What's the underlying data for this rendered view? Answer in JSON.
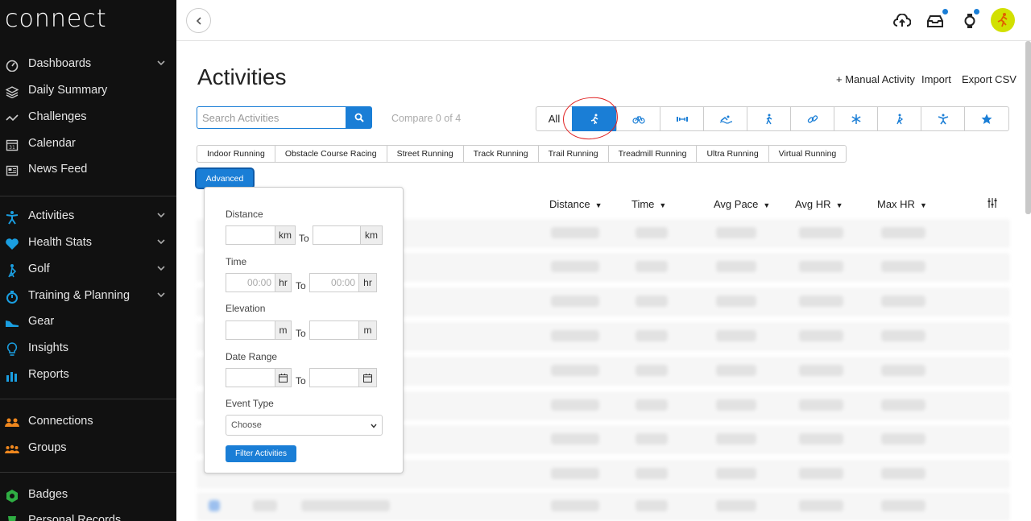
{
  "sidebar": {
    "logo": "connect",
    "items": [
      {
        "label": "Dashboards",
        "icon": "dashboard-icon",
        "chevron": true
      },
      {
        "label": "Daily Summary",
        "icon": "layers-icon",
        "chevron": false
      },
      {
        "label": "Challenges",
        "icon": "challenges-icon",
        "chevron": false
      },
      {
        "label": "Calendar",
        "icon": "calendar-icon",
        "chevron": false
      },
      {
        "label": "News Feed",
        "icon": "news-feed-icon",
        "chevron": false
      },
      {
        "label": "Activities",
        "icon": "activities-icon",
        "chevron": true
      },
      {
        "label": "Health Stats",
        "icon": "heart-icon",
        "chevron": true
      },
      {
        "label": "Golf",
        "icon": "golf-icon",
        "chevron": true
      },
      {
        "label": "Training & Planning",
        "icon": "stopwatch-icon",
        "chevron": true
      },
      {
        "label": "Gear",
        "icon": "shoe-icon",
        "chevron": false
      },
      {
        "label": "Insights",
        "icon": "lightbulb-icon",
        "chevron": false
      },
      {
        "label": "Reports",
        "icon": "bar-chart-icon",
        "chevron": false
      },
      {
        "label": "Connections",
        "icon": "connections-icon",
        "chevron": false
      },
      {
        "label": "Groups",
        "icon": "groups-icon",
        "chevron": false
      },
      {
        "label": "Badges",
        "icon": "badge-icon",
        "chevron": false
      },
      {
        "label": "Personal Records",
        "icon": "trophy-icon",
        "chevron": false
      }
    ]
  },
  "page": {
    "title": "Activities",
    "manual_activity": "+ Manual Activity",
    "import": "Import",
    "export_csv": "Export CSV",
    "search_placeholder": "Search Activities",
    "compare": "Compare 0 of 4"
  },
  "type_filters": {
    "all_label": "All",
    "icons": [
      "running-icon",
      "cycling-icon",
      "strength-icon",
      "swimming-icon",
      "walking-icon",
      "multisport-icon",
      "snowflake-icon",
      "golf-swing-icon",
      "fitness-icon",
      "star-icon"
    ],
    "active_index": 0
  },
  "subtypes": [
    "Indoor Running",
    "Obstacle Course Racing",
    "Street Running",
    "Track Running",
    "Trail Running",
    "Treadmill Running",
    "Ultra Running",
    "Virtual Running"
  ],
  "advanced": {
    "button": "Advanced",
    "distance_label": "Distance",
    "distance_unit": "km",
    "time_label": "Time",
    "time_placeholder": "00:00",
    "time_unit": "hr",
    "elevation_label": "Elevation",
    "elevation_unit": "m",
    "date_range_label": "Date Range",
    "to": "To",
    "event_type_label": "Event Type",
    "event_type_value": "Choose",
    "filter_button": "Filter Activities"
  },
  "columns": [
    "Distance",
    "Time",
    "Avg Pace",
    "Avg HR",
    "Max HR"
  ],
  "colors": {
    "accent": "#1a7ed6",
    "sidebar_bg": "#111111",
    "annotation": "#e02020",
    "avatar": "#d2e000"
  }
}
